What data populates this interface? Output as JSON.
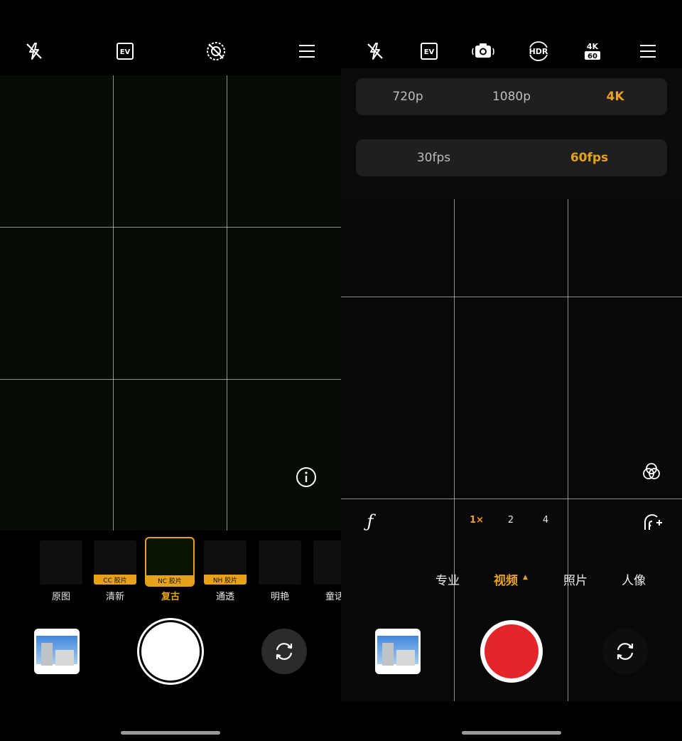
{
  "left": {
    "filters": [
      {
        "label": "原图",
        "tag": ""
      },
      {
        "label": "清新",
        "tag": "CC 胶片"
      },
      {
        "label": "复古",
        "tag": "NC 胶片"
      },
      {
        "label": "通透",
        "tag": "NH 胶片"
      },
      {
        "label": "明艳",
        "tag": ""
      },
      {
        "label": "童话",
        "tag": ""
      }
    ],
    "selected_filter": "复古"
  },
  "right": {
    "top_icons": {
      "ev": "EV",
      "hdr": "HDR",
      "res_badge_top": "4K",
      "res_badge_bottom": "60"
    },
    "resolution_options": [
      "720p",
      "1080p",
      "4K"
    ],
    "resolution_selected": "4K",
    "fps_options": [
      "30fps",
      "60fps"
    ],
    "fps_selected": "60fps",
    "aperture_symbol": "ƒ",
    "zoom_levels": [
      "1×",
      "2",
      "4"
    ],
    "modes": [
      "专业",
      "视频",
      "照片",
      "人像"
    ],
    "selected_mode": "视频",
    "mode_indicator": "▲"
  },
  "colors": {
    "accent": "#e6a21a",
    "record": "#e3262b",
    "viewfinder_left": "#060d04",
    "viewfinder_right": "#08080a"
  },
  "icons": [
    "flash-off-icon",
    "ev-icon",
    "ai-off-icon",
    "menu-icon",
    "live-photo-icon",
    "hdr-icon",
    "resolution-icon",
    "info-icon",
    "filters-icon",
    "aperture-icon",
    "beauty-icon",
    "switch-camera-icon"
  ]
}
